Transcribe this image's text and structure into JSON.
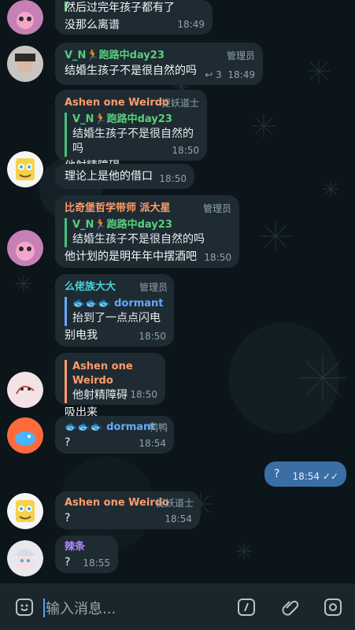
{
  "messages": [
    {
      "text_lines": [
        "然后过完年孩子都有了",
        "没那么离谱"
      ],
      "time": "18:49"
    },
    {
      "sender": "V_N🏃跑路中day23",
      "role": "管理员",
      "text": "结婚生孩子不是很自然的吗",
      "reply_count": "3",
      "time": "18:49"
    },
    {
      "sender": "Ashen one Weirdo",
      "role": "捉妖道士",
      "quote_name": "V_N🏃跑路中day23",
      "quote_text": "结婚生孩子不是很自然的吗",
      "text": "他射精障碍",
      "time": "18:50"
    },
    {
      "text": "理论上是他的借口",
      "time": "18:50"
    },
    {
      "sender": "比奇堡哲学带师 派大星",
      "role": "管理员",
      "quote_name": "V_N🏃跑路中day23",
      "quote_text": "结婚生孩子不是很自然的吗",
      "text": "他计划的是明年年中摆酒吧",
      "time": "18:50"
    },
    {
      "sender": "么佬族大大",
      "role": "管理员",
      "quote_name": "🐟🐟🐟 dormant",
      "quote_text": "抬到了一点点闪电",
      "text": "别电我",
      "time": "18:50"
    },
    {
      "quote_name": "Ashen one Weirdo",
      "quote_text": "他射精障碍",
      "text": "吸出来",
      "time": "18:50"
    },
    {
      "sender": "🐟🐟🐟 dormant",
      "role": "鸭鸭",
      "text": "?",
      "time": "18:54"
    },
    {
      "text": "?",
      "time": "18:54"
    },
    {
      "sender": "Ashen one Weirdo",
      "role": "捉妖道士",
      "text": "?",
      "time": "18:54"
    },
    {
      "sender": "辣条",
      "text": "?",
      "time": "18:55"
    }
  ],
  "composer": {
    "placeholder": "输入消息..."
  },
  "colors": {
    "accent": "#4ea4ff",
    "sender_green": "#57d07c",
    "sender_orange": "#ff9c6b",
    "sender_cyan": "#4ad3d9",
    "sender_blue": "#63a9ff",
    "sender_purple": "#b08cff"
  },
  "icons": {
    "sticker": "sticker-icon",
    "command": "command-icon",
    "attach": "paperclip-icon",
    "camera": "camera-icon",
    "forward": "reply-icon",
    "ticks": "double-check-icon"
  }
}
